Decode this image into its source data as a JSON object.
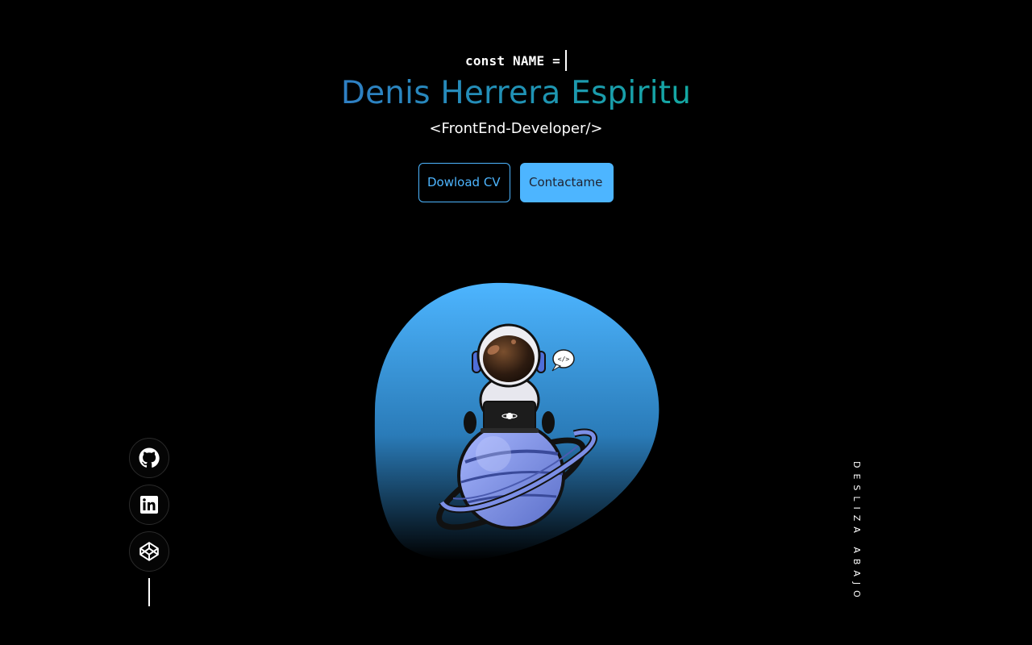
{
  "header": {
    "code_prefix": "const NAME =",
    "name": "Denis Herrera Espiritu",
    "role": "<FrontEnd-Developer/>"
  },
  "buttons": {
    "download_cv": "Dowload CV",
    "contact": "Contactame"
  },
  "colors": {
    "background": "#000000",
    "accent": "#4db5ff",
    "name_gradient_start": "#2f7fc4",
    "name_gradient_end": "#14a8a2"
  },
  "illustration": {
    "subject": "astronaut-with-laptop-on-planet",
    "bubble_text": "</>"
  },
  "socials": [
    {
      "icon": "github-icon"
    },
    {
      "icon": "linkedin-icon"
    },
    {
      "icon": "codepen-icon"
    }
  ],
  "scroll_hint": "DESLIZA ABAJO"
}
